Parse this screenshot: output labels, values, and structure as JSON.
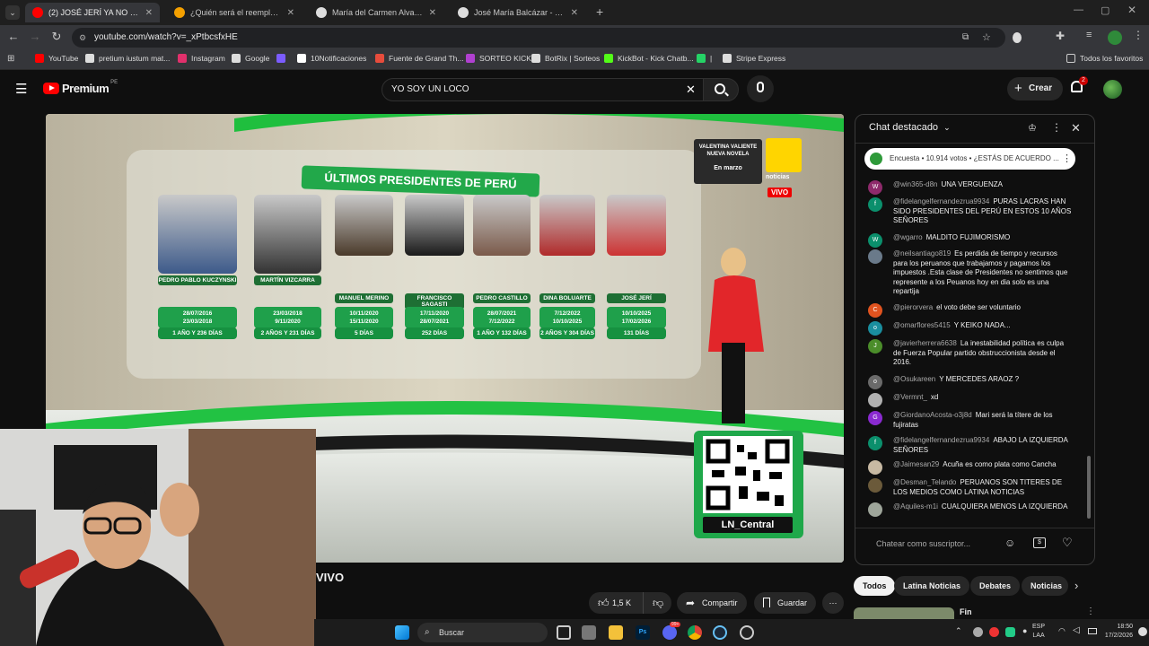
{
  "tabs": [
    {
      "title": "(2) JOSÉ JERÍ YA NO ES PRESID",
      "favicon_color": "#ff0000",
      "active": true
    },
    {
      "title": "¿Quién será el reemplazo de Jo",
      "favicon_color": "#f4a000",
      "active": false
    },
    {
      "title": "María del Carmen Alva Prieto -",
      "favicon_color": "#dddddd",
      "active": false
    },
    {
      "title": "José María Balcázar - Buscar co",
      "favicon_color": "#dddddd",
      "active": false
    }
  ],
  "url": "youtube.com/watch?v=_xPtbcsfxHE",
  "bookmarks": [
    {
      "label": "YouTube",
      "color": "#ff0000"
    },
    {
      "label": "pretium iustum mat...",
      "color": "#dddddd"
    },
    {
      "label": "Instagram",
      "color": "#e1306c"
    },
    {
      "label": "Google",
      "color": "#dddddd"
    },
    {
      "label": "",
      "color": "#7b5cff"
    },
    {
      "label": "10Notificaciones",
      "color": "#ffffff"
    },
    {
      "label": "Fuente de Grand Th...",
      "color": "#e74c3c"
    },
    {
      "label": "SORTEO KICK",
      "color": "#b040d0"
    },
    {
      "label": "BotRix | Sorteos",
      "color": "#dddddd"
    },
    {
      "label": "KickBot - Kick Chatb...",
      "color": "#53fc18"
    },
    {
      "label": "|",
      "color": "#25d366"
    },
    {
      "label": "Stripe Express",
      "color": "#dddddd"
    }
  ],
  "all_favorites": "Todos los favoritos",
  "yt": {
    "logo": "Premium",
    "region": "PE",
    "search_query": "YO SOY UN LOCO",
    "create": "Crear",
    "notif_count": "2"
  },
  "video": {
    "banner": "ÚLTIMOS PRESIDENTES DE PERÚ",
    "promo_line1": "VALENTINA VALIENTE",
    "promo_line2": "NUEVA NOVELA",
    "promo_line3": "En marzo",
    "channel_badge": "noticias",
    "live_badge": "VIVO",
    "qr_label": "LN_Central",
    "presidents": [
      {
        "name": "PEDRO PABLO KUCZYNSKI",
        "start": "28/07/2016",
        "end": "23/03/2018",
        "days": "1 AÑO Y 236 DÍAS"
      },
      {
        "name": "MARTÍN VIZCARRA",
        "start": "23/03/2018",
        "end": "9/11/2020",
        "days": "2 AÑOS Y 231 DÍAS"
      },
      {
        "name": "MANUEL MERINO",
        "start": "10/11/2020",
        "end": "15/11/2020",
        "days": "5 DÍAS"
      },
      {
        "name": "FRANCISCO SAGASTI",
        "start": "17/11/2020",
        "end": "28/07/2021",
        "days": "252 DÍAS"
      },
      {
        "name": "PEDRO CASTILLO",
        "start": "28/07/2021",
        "end": "7/12/2022",
        "days": "1 AÑO Y 132 DÍAS"
      },
      {
        "name": "DINA BOLUARTE",
        "start": "7/12/2022",
        "end": "10/10/2025",
        "days": "2 AÑOS Y 304 DÍAS"
      },
      {
        "name": "JOSÉ JERÍ",
        "start": "10/10/2025",
        "end": "17/02/2026",
        "days": "131 DÍAS"
      }
    ]
  },
  "title_fragment": "VIVO",
  "actions": {
    "likes": "1,5 K",
    "share": "Compartir",
    "save": "Guardar"
  },
  "chat": {
    "header": "Chat destacado",
    "poll": "Encuesta • 10.914 votos • ¿ESTÁS DE ACUERDO ...",
    "input_placeholder": "Chatear como suscriptor...",
    "messages": [
      {
        "author": "@win365-d8n",
        "text": "UNA VERGUENZA",
        "initial": "W",
        "color": "#8e2a6b"
      },
      {
        "author": "@fidelangelfernandezrua9934",
        "text": "PURAS LACRAS HAN SIDO PRESIDENTES DEL PERÚ EN ESTOS 10 AÑOS SEÑORES",
        "initial": "f",
        "color": "#0b8f6c"
      },
      {
        "author": "@wgarro",
        "text": "MALDITO FUJIMORISMO",
        "initial": "W",
        "color": "#0b8f6c"
      },
      {
        "author": "@neilsantiago819",
        "text": "Es perdida de tiempo y recursos para los peruanos que trabajamos y pagamos los impuestos .Esta clase de Presidentes no sentimos que represente a los Peuanos hoy en dia solo es una repartija",
        "initial": "",
        "color": "#6a7a8a"
      },
      {
        "author": "@pierorvera",
        "text": "el voto debe ser voluntario",
        "initial": "C",
        "color": "#e0531f"
      },
      {
        "author": "@omarflores5415",
        "text": "Y KEIKO NADA...",
        "initial": "o",
        "color": "#1a8e9e"
      },
      {
        "author": "@javierherrera6638",
        "text": "La inestabilidad política es culpa de Fuerza Popular partido obstruccionista desde el 2016.",
        "initial": "J",
        "color": "#4b8d2a"
      },
      {
        "author": "@Osukareen",
        "text": "Y MERCEDES ARAOZ ?",
        "initial": "o",
        "color": "#6a6a6a"
      },
      {
        "author": "@Vermnt_",
        "text": "xd",
        "initial": "",
        "color": "#b0b0b0"
      },
      {
        "author": "@GiordanoAcosta-o3j8d",
        "text": "Mari será la títere de los fujiratas",
        "initial": "G",
        "color": "#8a2ad0"
      },
      {
        "author": "@fidelangelfernandezrua9934",
        "text": "ABAJO LA IZQUIERDA SEÑORES",
        "initial": "f",
        "color": "#0b8f6c"
      },
      {
        "author": "@Jaimesan29",
        "text": "Acuña es como plata como Cancha",
        "initial": "",
        "color": "#c7b9a3"
      },
      {
        "author": "@Desman_Telando",
        "text": "PERUANOS SON TITERES DE LOS MEDIOS COMO LATINA NOTICIAS",
        "initial": "",
        "color": "#6b5a3a"
      },
      {
        "author": "@Aquiles-m1i",
        "text": "CUALQUIERA MENOS LA IZQUIERDA",
        "initial": "",
        "color": "#9ea59a"
      }
    ]
  },
  "chips": [
    "Todos",
    "Latina Noticias",
    "Debates",
    "Noticias"
  ],
  "related_title": "Fin",
  "taskbar": {
    "search": "Buscar",
    "lang": "ESP",
    "lang2": "LAA",
    "time": "18:50",
    "date": "17/2/2026",
    "discord_badge": "99+"
  }
}
